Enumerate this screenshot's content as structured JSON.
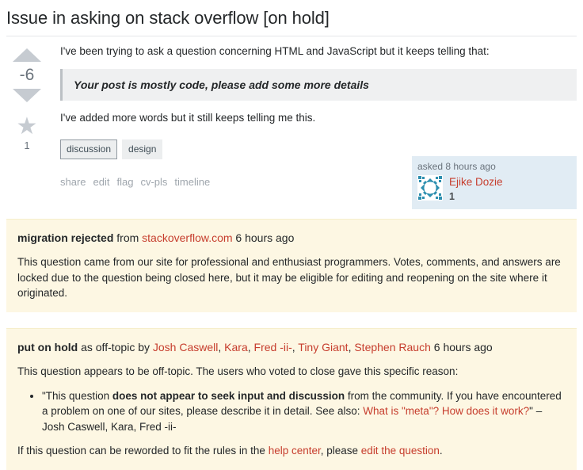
{
  "question": {
    "title": "Issue in asking on stack overflow [on hold]",
    "vote_count": "-6",
    "favorite_count": "1",
    "vote_up_icon": "arrow-up-icon",
    "vote_down_icon": "arrow-down-icon",
    "favorite_icon": "star-icon",
    "body": {
      "paragraph_1": "I've been trying to ask a question concerning HTML and JavaScript but it keeps telling that:",
      "blockquote": "Your post is mostly code, please add some more details",
      "paragraph_2": "I've added more words but it still keeps telling me this."
    },
    "tags": [
      {
        "label": "discussion",
        "style": "bordered"
      },
      {
        "label": "design",
        "style": "plain"
      }
    ],
    "menu": [
      {
        "label": "share"
      },
      {
        "label": "edit"
      },
      {
        "label": "flag"
      },
      {
        "label": "cv-pls"
      },
      {
        "label": "timeline"
      }
    ],
    "user_card": {
      "action_time": "asked 8 hours ago",
      "avatar_icon": "identicon-avatar",
      "avatar_color": "#2d8faf",
      "user_name": "Ejike Dozie",
      "reputation": "1"
    }
  },
  "migration_notice": {
    "head_bold": "migration rejected",
    "head_from": " from ",
    "head_link": "stackoverflow.com",
    "head_time": " 6 hours ago",
    "body": "This question came from our site for professional and enthusiast programmers. Votes, comments, and answers are locked due to the question being closed here, but it may be eligible for editing and reopening on the site where it originated."
  },
  "hold_notice": {
    "head_bold": "put on hold",
    "head_reason": " as off-topic by ",
    "closers": [
      "Josh Caswell",
      "Kara",
      "Fred -ii-",
      "Tiny Giant",
      "Stephen Rauch"
    ],
    "head_time": " 6 hours ago",
    "intro": "This question appears to be off-topic. The users who voted to close gave this specific reason:",
    "reason_part_1": "\"This question ",
    "reason_bold": "does not appear to seek input and discussion",
    "reason_part_2": " from the community. If you have encountered a problem on one of our sites, please describe it in detail. See also: ",
    "reason_link": "What is \"meta\"? How does it work?",
    "reason_part_3": "\" – Josh Caswell, Kara, Fred -ii-",
    "footer_part_1": "If this question can be reworded to fit the rules in the ",
    "footer_link_1": "help center",
    "footer_part_2": ", please ",
    "footer_link_2": "edit the question",
    "footer_part_3": "."
  },
  "colors": {
    "link_red": "#c63d2d",
    "notice_bg": "#fdf7e3",
    "user_card_bg": "#e1ecf4",
    "quote_bg": "#eff0f1",
    "tag_bg": "#eceeef",
    "muted_text": "#9fa6ad"
  }
}
